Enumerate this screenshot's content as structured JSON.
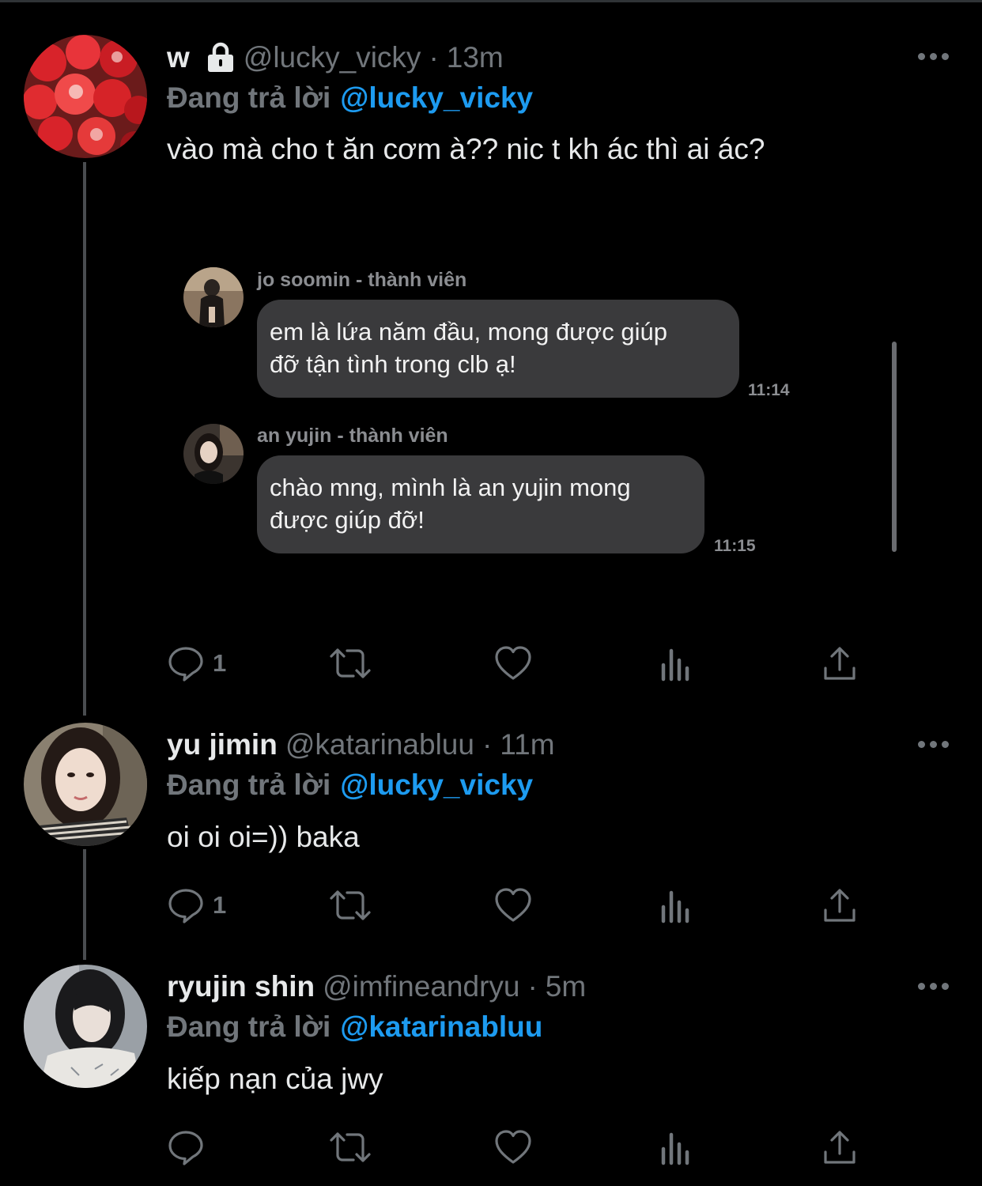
{
  "colors": {
    "background": "#000000",
    "primary_text": "#e7e9ea",
    "secondary_text": "#71767b",
    "mention": "#1d9bf0",
    "bubble": "#3a3a3c"
  },
  "tweets": [
    {
      "name": "w",
      "protected": true,
      "handle": "@lucky_vicky",
      "time": "13m",
      "replying_label": "Đang trả lời",
      "replying_to": "@lucky_vicky",
      "text": "vào mà cho t ăn cơm à?? nic t kh ác thì ai ác?",
      "reply_count": "1",
      "embedded_chat": {
        "messages": [
          {
            "sender": "jo soomin - thành viên",
            "lines": [
              "em là lứa năm đầu, mong được giúp",
              "đỡ tận tình trong clb ạ!"
            ],
            "time": "11:14"
          },
          {
            "sender": "an yujin - thành viên",
            "lines": [
              "chào mng, mình là an yujin mong",
              "được giúp đỡ!"
            ],
            "time": "11:15"
          }
        ]
      }
    },
    {
      "name": "yu jimin",
      "handle": "@katarinabluu",
      "time": "11m",
      "replying_label": "Đang trả lời",
      "replying_to": "@lucky_vicky",
      "text": "oi oi oi=)) baka",
      "reply_count": "1"
    },
    {
      "name": "ryujin shin",
      "handle": "@imfineandryu",
      "time": "5m",
      "replying_label": "Đang trả lời",
      "replying_to": "@katarinabluu",
      "text": "kiếp nạn của jwy",
      "reply_count": ""
    }
  ],
  "icons": [
    "lock-icon",
    "more-icon",
    "reply-icon",
    "retweet-icon",
    "like-icon",
    "views-icon",
    "share-icon"
  ]
}
